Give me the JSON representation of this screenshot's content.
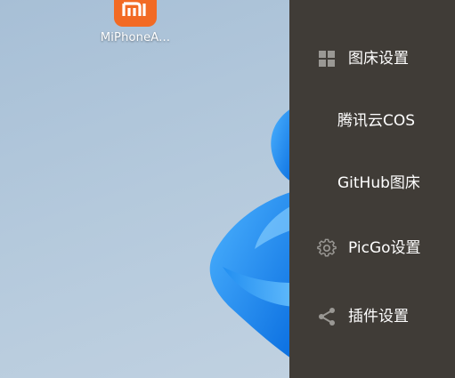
{
  "desktop": {
    "icon_label": "MiPhoneA...",
    "icon_name": "mi-app-icon",
    "icon_color": "#f26a24"
  },
  "menu": {
    "background": "#403c37",
    "items": [
      {
        "label": "图床设置",
        "icon": "grid-icon"
      },
      {
        "label": "腾讯云COS"
      },
      {
        "label": "GitHub图床"
      },
      {
        "label": "PicGo设置",
        "icon": "gear-icon"
      },
      {
        "label": "插件设置",
        "icon": "share-icon"
      }
    ]
  }
}
